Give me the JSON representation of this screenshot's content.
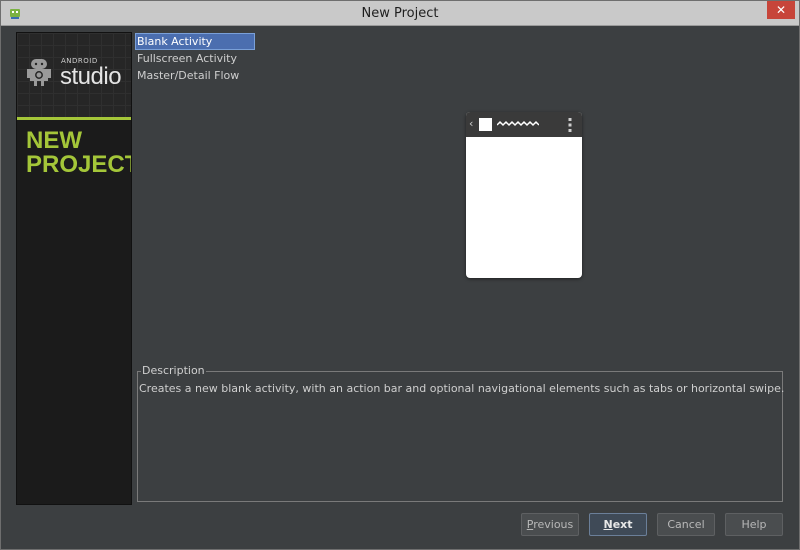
{
  "window": {
    "title": "New Project",
    "close_glyph": "✕"
  },
  "sidebar": {
    "logo_android": "ANDROID",
    "logo_studio": "studio",
    "heading_line1": "NEW",
    "heading_line2": "PROJECT",
    "accent_color": "#a4c639"
  },
  "activity_list": {
    "items": [
      {
        "label": "Blank Activity",
        "selected": true
      },
      {
        "label": "Fullscreen Activity",
        "selected": false
      },
      {
        "label": "Master/Detail Flow",
        "selected": false
      }
    ],
    "selection_color": "#4b6eaf"
  },
  "preview": {
    "icons": [
      "chevron-left-icon",
      "app-icon",
      "title-squiggle-icon",
      "overflow-menu-icon"
    ]
  },
  "description": {
    "legend": "Description",
    "text": "Creates a new blank activity, with an action bar and optional navigational elements such as tabs or horizontal swipe."
  },
  "buttons": {
    "previous": {
      "mnemonic": "P",
      "rest": "revious"
    },
    "next": {
      "mnemonic": "N",
      "rest": "ext"
    },
    "cancel": "Cancel",
    "help": "Help"
  }
}
